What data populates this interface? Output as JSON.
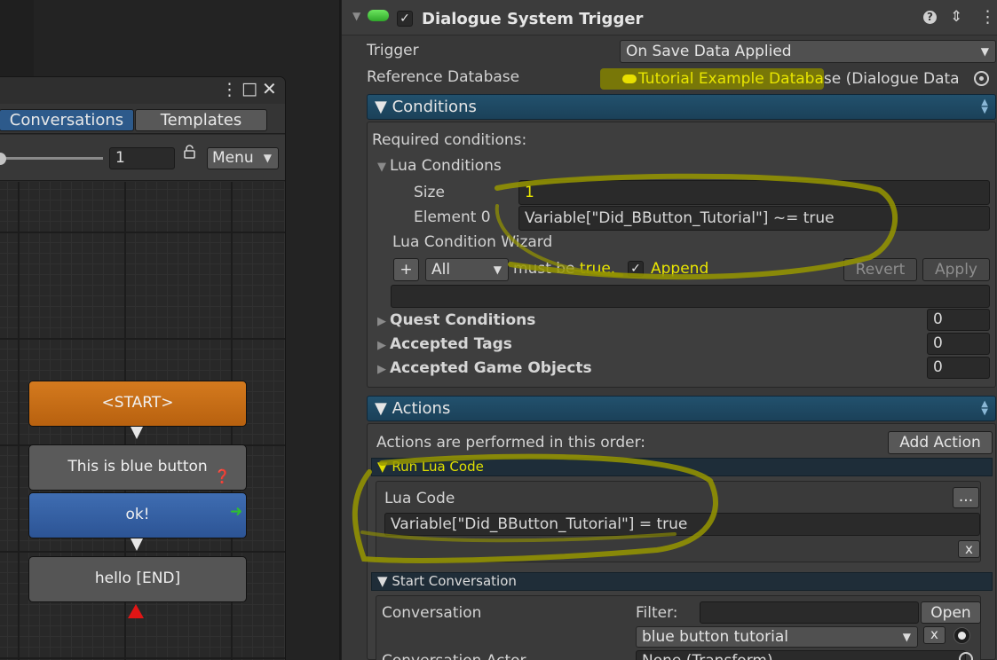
{
  "editor": {
    "tabs": [
      {
        "label": "Conversations",
        "active": true
      },
      {
        "label": "Templates",
        "active": false
      }
    ],
    "zoom_value": "1",
    "menu_label": "Menu",
    "nodes": [
      {
        "label": "<START>",
        "color": "#c86e17"
      },
      {
        "label": "This is blue button >>>>>>",
        "color": "#5a5a5a"
      },
      {
        "label": "ok!",
        "color": "#3561a5"
      },
      {
        "label": "hello [END]",
        "color": "#555555"
      }
    ]
  },
  "component": {
    "title": "Dialogue System Trigger",
    "trigger_label": "Trigger",
    "trigger_value": "On Save Data Applied",
    "db_label": "Reference Database",
    "db_value_highlighted": "Tutorial Example Databa",
    "db_value_rest": "se (Dialogue Data"
  },
  "conditions": {
    "header": "Conditions",
    "required_label": "Required conditions:",
    "lua_conditions_label": "Lua Conditions",
    "size_label": "Size",
    "size_value": "1",
    "element0_label": "Element 0",
    "element0_value": "Variable[\"Did_BButton_Tutorial\"] ~= true",
    "wizard_label": "Lua Condition Wizard",
    "add_label": "+",
    "all_value": "All",
    "must_be_prefix": "must be ",
    "must_be_true": "true.",
    "append_label": "Append",
    "revert_label": "Revert",
    "apply_label": "Apply",
    "quest_label": "Quest Conditions",
    "quest_value": "0",
    "tags_label": "Accepted Tags",
    "tags_value": "0",
    "objects_label": "Accepted Game Objects",
    "objects_value": "0"
  },
  "actions": {
    "header": "Actions",
    "order_label": "Actions are performed in this order:",
    "add_action_label": "Add Action",
    "run_lua_header": "Run Lua Code",
    "lua_code_label": "Lua Code",
    "ellipsis_label": "...",
    "lua_code_value": "Variable[\"Did_BButton_Tutorial\"] = true",
    "remove_label": "x",
    "start_conv_header": "Start Conversation",
    "conversation_label": "Conversation",
    "filter_label": "Filter:",
    "open_label": "Open",
    "conversation_value": "blue button tutorial",
    "clear_label": "x",
    "actor_label": "Conversation Actor",
    "actor_value": "None (Transform)"
  },
  "colors": {
    "accent_blue": "#2d5a8b",
    "section_bar": "#22516d",
    "highlight_yellow": "#e9e600"
  }
}
